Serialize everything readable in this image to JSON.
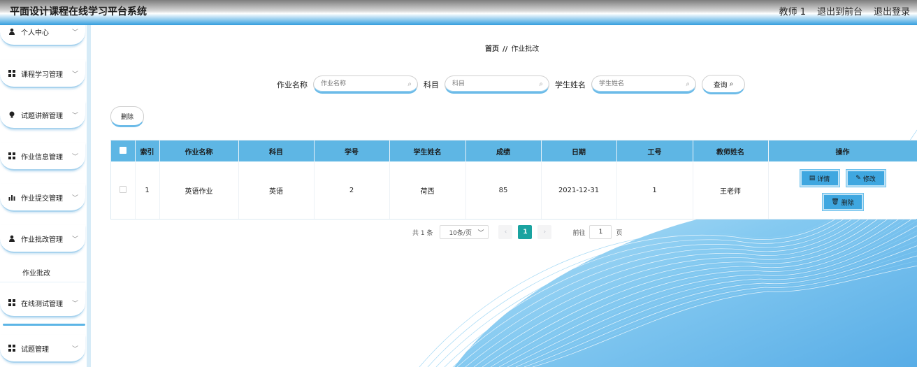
{
  "app": {
    "title": "平面设计课程在线学习平台系统",
    "user_label": "教师 1",
    "to_front": "退出到前台",
    "logout": "退出登录"
  },
  "sidebar": {
    "items": [
      {
        "label": "个人中心",
        "icon": "user-icon"
      },
      {
        "label": "课程学习管理",
        "icon": "grid-icon"
      },
      {
        "label": "试题讲解管理",
        "icon": "bulb-icon"
      },
      {
        "label": "作业信息管理",
        "icon": "grid-icon"
      },
      {
        "label": "作业提交管理",
        "icon": "bar-chart-icon"
      },
      {
        "label": "作业批改管理",
        "icon": "user-icon"
      },
      {
        "label": "在线测试管理",
        "icon": "grid-icon"
      },
      {
        "label": "试题管理",
        "icon": "grid-icon"
      }
    ],
    "submenu": {
      "label": "作业批改"
    },
    "arrow": "﹀"
  },
  "breadcrumb": {
    "home": "首页",
    "sep": "//",
    "current": "作业批改"
  },
  "search": {
    "fields": [
      {
        "label": "作业名称",
        "placeholder": "作业名称"
      },
      {
        "label": "科目",
        "placeholder": "科目"
      },
      {
        "label": "学生姓名",
        "placeholder": "学生姓名"
      }
    ],
    "query_label": "查询"
  },
  "actions": {
    "delete_label": "删除"
  },
  "table": {
    "headers": [
      "索引",
      "作业名称",
      "科目",
      "学号",
      "学生姓名",
      "成绩",
      "日期",
      "工号",
      "教师姓名",
      "操作"
    ],
    "rows": [
      {
        "index": "1",
        "name": "英语作业",
        "subject": "英语",
        "student_no": "2",
        "student_name": "荷西",
        "score": "85",
        "date": "2021-12-31",
        "work_no": "1",
        "teacher": "王老师"
      }
    ],
    "ops": {
      "detail": "详情",
      "edit": "修改",
      "delete": "删除"
    }
  },
  "pagination": {
    "total": "共 1 条",
    "page_size": "10条/页",
    "current_page": "1",
    "goto_prefix": "前往",
    "goto_value": "1",
    "goto_suffix": "页"
  },
  "colors": {
    "accent": "#5eb6e4",
    "pager_active": "#1aa3a0",
    "header_bottom": "#3ea3e0"
  }
}
